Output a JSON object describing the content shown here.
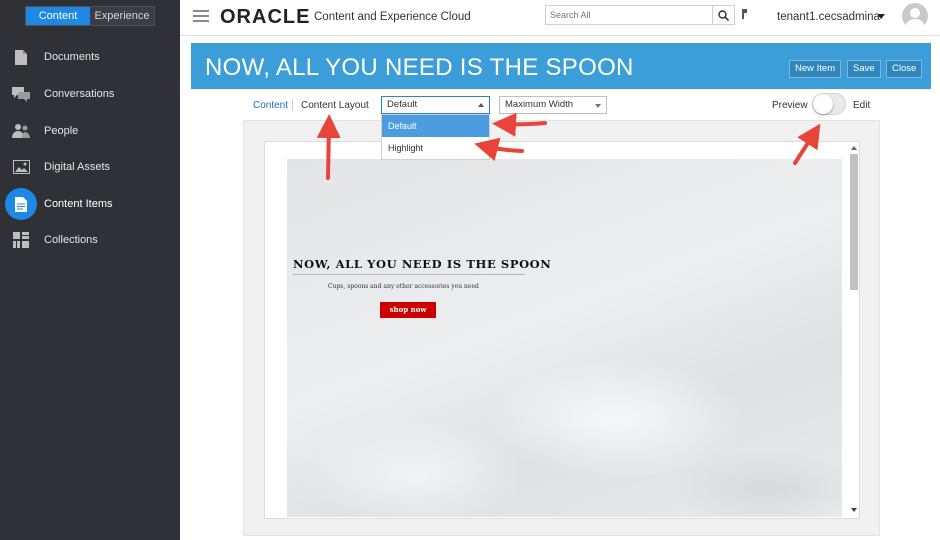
{
  "sidebar": {
    "switch": {
      "content": "Content",
      "experience": "Experience"
    },
    "items": [
      {
        "label": "Documents",
        "icon": "document-icon"
      },
      {
        "label": "Conversations",
        "icon": "conversations-icon"
      },
      {
        "label": "People",
        "icon": "people-icon"
      },
      {
        "label": "Digital Assets",
        "icon": "image-icon"
      },
      {
        "label": "Content Items",
        "icon": "content-item-icon",
        "active": true
      },
      {
        "label": "Collections",
        "icon": "grid-icon"
      }
    ]
  },
  "topbar": {
    "logo": "ORACLE",
    "app_title": "Content and Experience Cloud",
    "search_placeholder": "Search All",
    "user": "tenant1.cecsadmina"
  },
  "banner": {
    "title": "NOW, ALL YOU NEED IS THE SPOON",
    "new_item": "New Item",
    "save": "Save",
    "close": "Close"
  },
  "toolbar": {
    "content_link": "Content",
    "content_layout_label": "Content Layout",
    "layout_select": "Default",
    "layout_options": [
      "Default",
      "Highlight"
    ],
    "width_select": "Maximum Width",
    "preview_label": "Preview",
    "edit_label": "Edit"
  },
  "preview": {
    "title": "NOW, ALL YOU NEED IS THE SPOON",
    "subtitle": "Cups, spoons and any other accessories you need",
    "button": "shop now"
  },
  "colors": {
    "accent": "#1e88e5",
    "banner": "#3b9ed8",
    "sidebar": "#2f3136",
    "shop_button": "#cc0000",
    "arrow": "#e8443a"
  }
}
